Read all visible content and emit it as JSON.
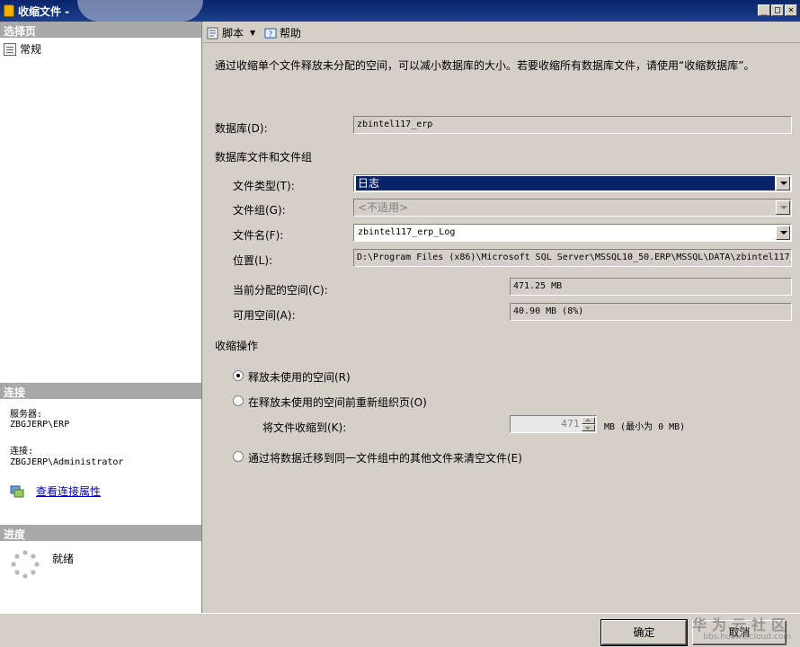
{
  "window": {
    "title": "收缩文件 -",
    "buttons": {
      "minimize": "_",
      "maximize": "□",
      "close": "×"
    }
  },
  "left_pane": {
    "select_page_header": "选择页",
    "nav_items": [
      {
        "label": "常规",
        "icon": "general-page-icon"
      }
    ],
    "connection_header": "连接",
    "server_label": "服务器:",
    "server_value": "ZBGJERP\\ERP",
    "connection_label": "连接:",
    "connection_value": "ZBGJERP\\Administrator",
    "view_connection_properties": "查看连接属性",
    "progress_header": "进度",
    "progress_status": "就绪"
  },
  "toolbar": {
    "script_label": "脚本",
    "help_label": "帮助"
  },
  "form": {
    "description": "通过收缩单个文件释放未分配的空间，可以减小数据库的大小。若要收缩所有数据库文件，请使用“收缩数据库”。",
    "database_label": "数据库(D):",
    "database_value": "zbintel117_erp",
    "files_section_label": "数据库文件和文件组",
    "file_type_label": "文件类型(T):",
    "file_type_value": "日志",
    "filegroup_label": "文件组(G):",
    "filegroup_value": "<不适用>",
    "file_name_label": "文件名(F):",
    "file_name_value": "zbintel117_erp_Log",
    "location_label": "位置(L):",
    "location_value": "D:\\Program Files (x86)\\Microsoft SQL Server\\MSSQL10_50.ERP\\MSSQL\\DATA\\zbintel117_",
    "allocated_label": "当前分配的空间(C):",
    "allocated_value": "471.25 MB",
    "available_label": "可用空间(A):",
    "available_value": "40.90 MB (8%)",
    "shrink_action_label": "收缩操作",
    "option_release": "释放未使用的空间(R)",
    "option_reorganize": "在释放未使用的空间前重新组织页(O)",
    "shrink_to_label": "将文件收缩到(K):",
    "shrink_to_value": "471",
    "shrink_to_unit": "MB (最小为 0 MB)",
    "option_empty": "通过将数据迁移到同一文件组中的其他文件来清空文件(E)"
  },
  "buttons": {
    "ok": "确定",
    "cancel": "取消"
  },
  "watermark": {
    "line1": "华为云社区",
    "line2": "bbs.huaweicloud.com"
  }
}
